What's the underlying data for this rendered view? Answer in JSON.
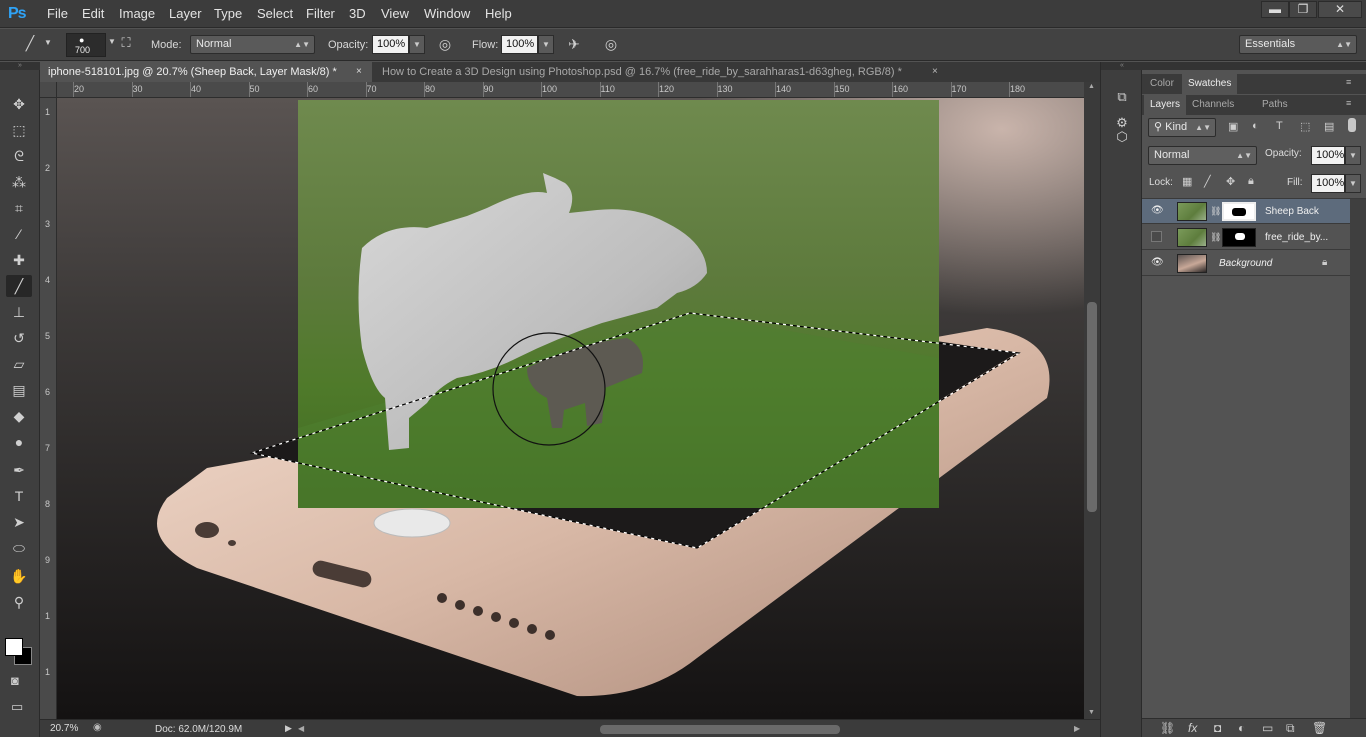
{
  "app": {
    "logo": "Ps"
  },
  "menu": [
    "File",
    "Edit",
    "Image",
    "Layer",
    "Type",
    "Select",
    "Filter",
    "3D",
    "View",
    "Window",
    "Help"
  ],
  "window_controls": {
    "minimize": "▬",
    "restore": "❐",
    "close": "✕"
  },
  "options": {
    "brush_size": "700",
    "mode_label": "Mode:",
    "mode_value": "Normal",
    "opacity_label": "Opacity:",
    "opacity_value": "100%",
    "flow_label": "Flow:",
    "flow_value": "100%",
    "workspace": "Essentials"
  },
  "tabs": [
    {
      "title": "iphone-518101.jpg @ 20.7% (Sheep Back, Layer Mask/8) *",
      "close": "×"
    },
    {
      "title": "How to Create a 3D Design using Photoshop.psd @ 16.7% (free_ride_by_sarahharas1-d63gheg, RGB/8) *",
      "close": "×"
    }
  ],
  "ruler_top": [
    "20",
    "30",
    "40",
    "50",
    "60",
    "70",
    "80",
    "90",
    "100",
    "110",
    "120",
    "130",
    "140",
    "150",
    "160",
    "170",
    "180"
  ],
  "ruler_left": [
    "1",
    "2",
    "3",
    "4",
    "5",
    "6",
    "7",
    "8",
    "9",
    "1",
    "1"
  ],
  "tools": [
    {
      "name": "move-tool-icon",
      "glyph": "✥"
    },
    {
      "name": "marquee-tool-icon",
      "glyph": "⬚"
    },
    {
      "name": "lasso-tool-icon",
      "glyph": "ᘓ"
    },
    {
      "name": "quick-select-tool-icon",
      "glyph": "⁂"
    },
    {
      "name": "crop-tool-icon",
      "glyph": "⌗"
    },
    {
      "name": "eyedropper-tool-icon",
      "glyph": "⁄"
    },
    {
      "name": "healing-brush-tool-icon",
      "glyph": "✚"
    },
    {
      "name": "brush-tool-icon",
      "glyph": "╱"
    },
    {
      "name": "clone-stamp-tool-icon",
      "glyph": "⊥"
    },
    {
      "name": "history-brush-tool-icon",
      "glyph": "↺"
    },
    {
      "name": "eraser-tool-icon",
      "glyph": "▱"
    },
    {
      "name": "gradient-tool-icon",
      "glyph": "▤"
    },
    {
      "name": "blur-tool-icon",
      "glyph": "◆"
    },
    {
      "name": "dodge-tool-icon",
      "glyph": "●"
    },
    {
      "name": "pen-tool-icon",
      "glyph": "✒"
    },
    {
      "name": "type-tool-icon",
      "glyph": "T"
    },
    {
      "name": "path-select-tool-icon",
      "glyph": "➤"
    },
    {
      "name": "ellipse-tool-icon",
      "glyph": "⬭"
    },
    {
      "name": "hand-tool-icon",
      "glyph": "✋"
    },
    {
      "name": "zoom-tool-icon",
      "glyph": "⚲"
    }
  ],
  "status": {
    "zoom": "20.7%",
    "doc": "Doc: 62.0M/120.9M",
    "arrow": "▶"
  },
  "panels": {
    "top_tabs": [
      "Color",
      "Swatches"
    ],
    "layer_tabs": [
      "Layers",
      "Channels",
      "Paths"
    ],
    "filter_kind": "Kind",
    "blend_mode": "Normal",
    "opacity_label": "Opacity:",
    "opacity_value": "100%",
    "lock_label": "Lock:",
    "fill_label": "Fill:",
    "fill_value": "100%"
  },
  "layers": [
    {
      "name": "Sheep Back",
      "visible": true,
      "selected": true,
      "italic": false
    },
    {
      "name": "free_ride_by...",
      "visible": false,
      "selected": false,
      "italic": false
    },
    {
      "name": "Background",
      "visible": true,
      "selected": false,
      "italic": true
    }
  ],
  "colors": {
    "accent": "#2fa3f6",
    "selected_layer": "#5d6b7c",
    "menu_bg": "#3c3c3c",
    "panel_bg": "#535353"
  }
}
